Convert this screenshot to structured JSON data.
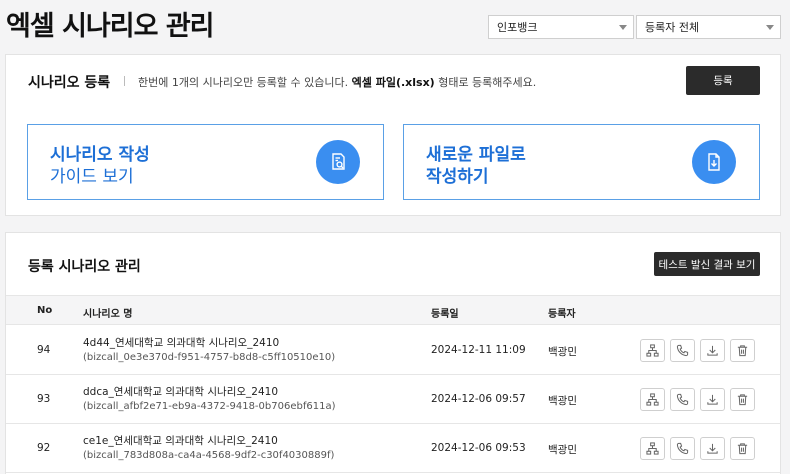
{
  "page": {
    "title": "엑셀 시나리오 관리"
  },
  "filters": {
    "bank": "인포뱅크",
    "owner": "등록자 전체"
  },
  "register": {
    "title": "시나리오 등록",
    "desc_before": "한번에 1개의 시나리오만 등록할 수 있습니다.",
    "desc_bold": "엑셀 파일(.xlsx)",
    "desc_after": "형태로 등록해주세요.",
    "button": "등록",
    "guide_card": {
      "line1": "시나리오 작성",
      "line2": "가이드 보기",
      "icon": "document-search-icon"
    },
    "new_file_card": {
      "line1": "새로운 파일로",
      "line2": "작성하기",
      "icon": "file-download-icon"
    }
  },
  "manage": {
    "title": "등록 시나리오 관리",
    "test_button": "테스트 발신 결과 보기",
    "columns": {
      "no": "No",
      "name": "시나리오 명",
      "date": "등록일",
      "owner": "등록자"
    },
    "rows": [
      {
        "no": "94",
        "name": "4d44_연세대학교 의과대학 시나리오_2410",
        "id": "(bizcall_0e3e370d-f951-4757-b8d8-c5ff10510e10)",
        "date": "2024-12-11 11:09",
        "owner": "백광민"
      },
      {
        "no": "93",
        "name": "ddca_연세대학교 의과대학 시나리오_2410",
        "id": "(bizcall_afbf2e71-eb9a-4372-9418-0b706ebf611a)",
        "date": "2024-12-06 09:57",
        "owner": "백광민"
      },
      {
        "no": "92",
        "name": "ce1e_연세대학교 의과대학 시나리오_2410",
        "id": "(bizcall_783d808a-ca4a-4568-9df2-c30f4030889f)",
        "date": "2024-12-06 09:53",
        "owner": "백광민"
      }
    ],
    "row_actions": [
      "flow-chart-icon",
      "phone-icon",
      "download-icon",
      "trash-icon"
    ]
  }
}
